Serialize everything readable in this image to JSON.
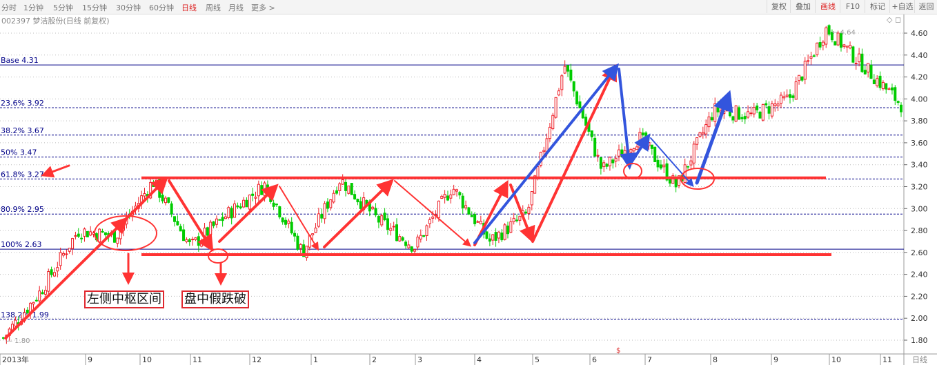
{
  "toolbar": {
    "tabs": [
      "分时",
      "1分钟",
      "5分钟",
      "15分钟",
      "30分钟",
      "60分钟",
      "日线",
      "周线",
      "月线",
      "更多 >"
    ],
    "active_tab": "日线",
    "right_buttons": [
      "复权",
      "叠加",
      "画线",
      "F10",
      "标记",
      "+自选",
      "返回"
    ],
    "active_right": "画线"
  },
  "stock_title": "002397 梦洁股份(日线 前复权)",
  "window_controls": "◇ ◻",
  "colors": {
    "up": "#ee1c24",
    "down": "#00cc00",
    "annotation": "#ff3333",
    "arrow_blue": "#3355dd",
    "fib": "#000088"
  },
  "chart_data": {
    "type": "candlestick",
    "y_axis": {
      "min": 1.8,
      "max": 4.6,
      "ticks": [
        "4.60",
        "4.40",
        "4.20",
        "4.00",
        "3.80",
        "3.60",
        "3.40",
        "3.20",
        "3.00",
        "2.80",
        "2.60",
        "2.40",
        "2.20",
        "2.00",
        "1.80"
      ]
    },
    "x_axis": {
      "labels": [
        "2013年",
        "9",
        "10",
        "11",
        "12",
        "1",
        "2",
        "3",
        "4",
        "5",
        "6",
        "7",
        "8",
        "9",
        "10",
        "11"
      ],
      "period_label": "日线"
    },
    "fib_levels": [
      {
        "label": "Base 4.31",
        "value": 4.31
      },
      {
        "label": "23.6% 3.92",
        "value": 3.92
      },
      {
        "label": "38.2% 3.67",
        "value": 3.67
      },
      {
        "label": "50% 3.47",
        "value": 3.47
      },
      {
        "label": "61.8% 3.27",
        "value": 3.27
      },
      {
        "label": "80.9% 2.95",
        "value": 2.95
      },
      {
        "label": "100% 2.63",
        "value": 2.63
      },
      {
        "label": "138.2% 1.99",
        "value": 1.99
      }
    ],
    "extremes": {
      "high_label": "4.64",
      "low_label": "1.80"
    },
    "price_path": [
      {
        "month": "2013年",
        "price": 1.82
      },
      {
        "month": "9",
        "price": 2.25
      },
      {
        "month": "9",
        "price": 2.8
      },
      {
        "month": "10",
        "price": 2.75
      },
      {
        "month": "10",
        "price": 3.25
      },
      {
        "month": "11",
        "price": 2.65
      },
      {
        "month": "11",
        "price": 2.95
      },
      {
        "month": "12",
        "price": 3.22
      },
      {
        "month": "1",
        "price": 2.6
      },
      {
        "month": "2",
        "price": 3.27
      },
      {
        "month": "3",
        "price": 2.9
      },
      {
        "month": "4",
        "price": 2.65
      },
      {
        "month": "4",
        "price": 3.2
      },
      {
        "month": "5",
        "price": 2.7
      },
      {
        "month": "6",
        "price": 2.95
      },
      {
        "month": "6",
        "price": 4.31
      },
      {
        "month": "7",
        "price": 3.35
      },
      {
        "month": "7",
        "price": 3.65
      },
      {
        "month": "8",
        "price": 3.2
      },
      {
        "month": "8",
        "price": 3.9
      },
      {
        "month": "9",
        "price": 3.85
      },
      {
        "month": "10",
        "price": 4.0
      },
      {
        "month": "10",
        "price": 4.64
      },
      {
        "month": "11",
        "price": 4.3
      },
      {
        "month": "11",
        "price": 3.95
      }
    ],
    "annotations": {
      "resistance_level": 3.28,
      "support_level": 2.58,
      "callouts": [
        "左侧中枢区间",
        "盘中假跌破"
      ]
    }
  }
}
